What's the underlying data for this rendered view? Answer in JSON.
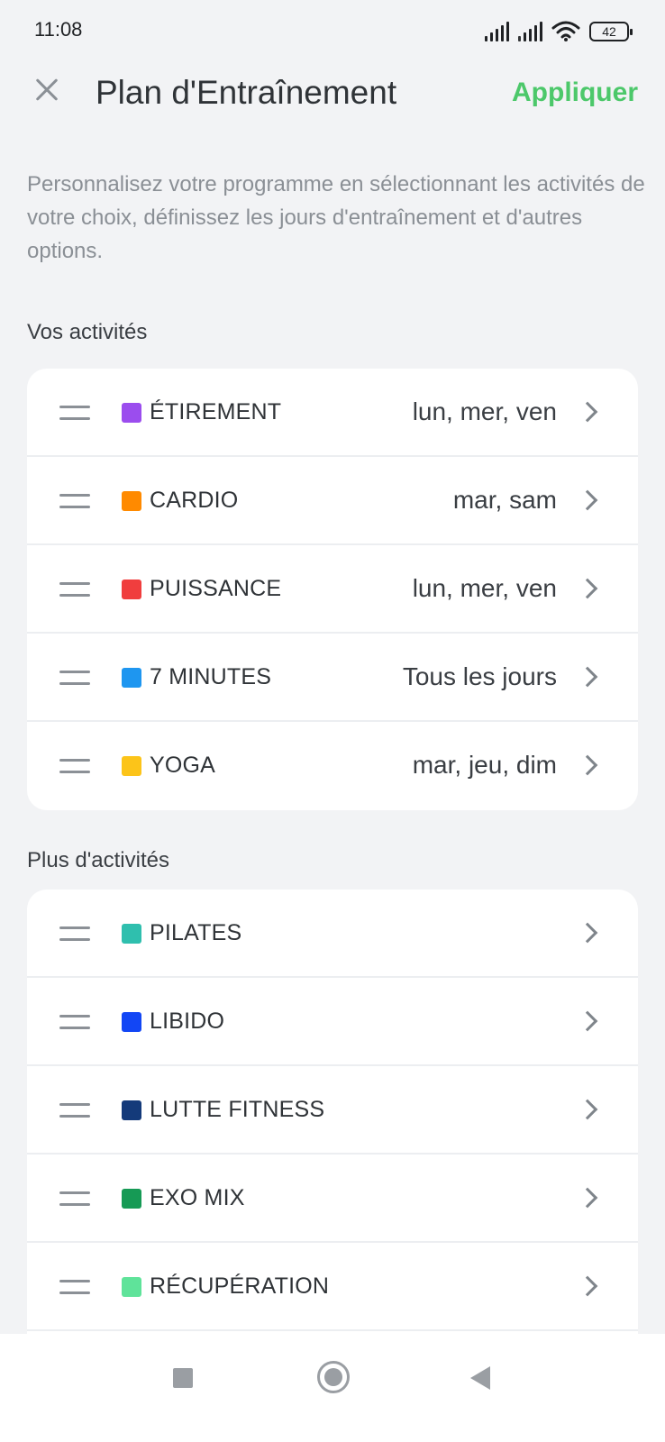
{
  "status_bar": {
    "time": "11:08",
    "battery": "42"
  },
  "header": {
    "title": "Plan d'Entraînement",
    "apply_label": "Appliquer"
  },
  "description": "Personnalisez votre programme en sélectionnant les activités de votre choix, définissez les jours d'entraînement et d'autres options.",
  "sections": {
    "my_activities": {
      "title": "Vos activités",
      "items": [
        {
          "name": "ÉTIREMENT",
          "days": "lun, mer, ven",
          "color": "#9b4dee"
        },
        {
          "name": "CARDIO",
          "days": "mar, sam",
          "color": "#ff8a00"
        },
        {
          "name": "PUISSANCE",
          "days": "lun, mer, ven",
          "color": "#f03e3e"
        },
        {
          "name": "7 MINUTES",
          "days": "Tous les jours",
          "color": "#1e96f0"
        },
        {
          "name": "YOGA",
          "days": "mar, jeu, dim",
          "color": "#fcc419"
        }
      ]
    },
    "more_activities": {
      "title": "Plus d'activités",
      "items": [
        {
          "name": "PILATES",
          "days": "",
          "color": "#2fbfae"
        },
        {
          "name": "LIBIDO",
          "days": "",
          "color": "#1246f5"
        },
        {
          "name": "LUTTE FITNESS",
          "days": "",
          "color": "#143a7a"
        },
        {
          "name": "EXO MIX",
          "days": "",
          "color": "#169a55"
        },
        {
          "name": "RÉCUPÉRATION",
          "days": "",
          "color": "#5fe39a"
        }
      ]
    }
  },
  "colors": {
    "accent": "#4cc86a",
    "background": "#f2f3f5"
  }
}
